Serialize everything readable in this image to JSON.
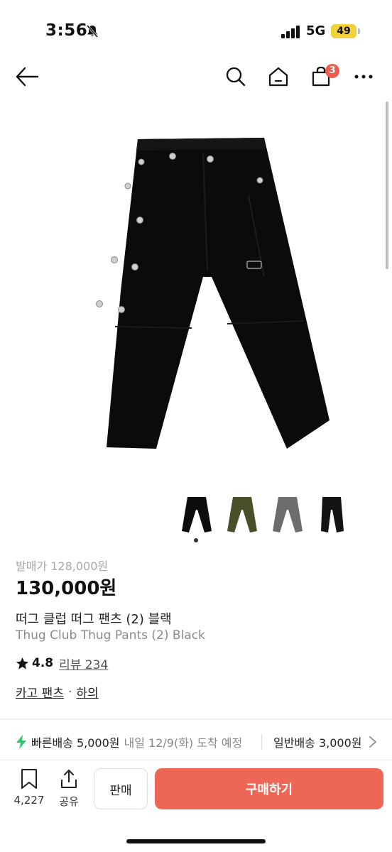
{
  "status_bar": {
    "time": "3:56",
    "network": "5G",
    "battery": "49"
  },
  "nav": {
    "cart_count": "3",
    "icons": [
      "back-arrow-icon",
      "search-icon",
      "home-icon",
      "cart-icon",
      "more-icon"
    ]
  },
  "product": {
    "original_price": "발매가 128,000원",
    "price": "130,000원",
    "title_ko": "떠그 클럽 떠그 팬츠 (2) 블랙",
    "title_en": "Thug Club Thug Pants (2) Black",
    "rating": "4.8",
    "review_label": "리뷰 234",
    "category_main": "카고 팬츠",
    "category_separator": "·",
    "category_sub": "하의",
    "color_options": [
      "black",
      "olive",
      "gray",
      "black"
    ],
    "selected_color_index": 0
  },
  "shipping": {
    "fast_label": "빠른배송 5,000원",
    "fast_eta": "내일 12/9(화) 도착 예정",
    "normal_label": "일반배송 3,000원"
  },
  "bottom_bar": {
    "like_count": "4,227",
    "share_label": "공유",
    "sell_label": "판매",
    "buy_label": "구매하기"
  },
  "colors": {
    "accent": "#ee6655",
    "badge": "#ee5b4b",
    "bolt": "#2ec66b",
    "battery": "#f2d23c"
  }
}
